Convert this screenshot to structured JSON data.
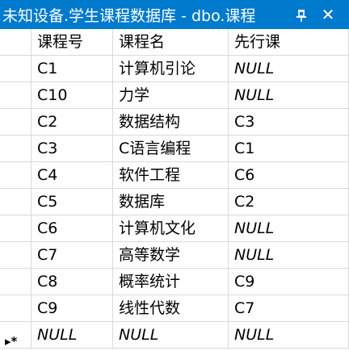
{
  "window": {
    "title": "未知设备.学生课程数据库 - dbo.课程",
    "pin_icon": "pin-icon",
    "close_icon": "close-icon",
    "close_glyph": "✕"
  },
  "grid": {
    "columns": [
      "课程号",
      "课程名",
      "先行课"
    ],
    "rows": [
      [
        "C1",
        "计算机引论",
        "NULL"
      ],
      [
        "C10",
        "力学",
        "NULL"
      ],
      [
        "C2",
        "数据结构",
        "C3"
      ],
      [
        "C3",
        "C语言编程",
        "C1"
      ],
      [
        "C4",
        "软件工程",
        "C6"
      ],
      [
        "C5",
        "数据库",
        "C2"
      ],
      [
        "C6",
        "计算机文化",
        "NULL"
      ],
      [
        "C7",
        "高等数学",
        "NULL"
      ],
      [
        "C8",
        "概率统计",
        "C9"
      ],
      [
        "C9",
        "线性代数",
        "C7"
      ]
    ],
    "new_row": [
      "NULL",
      "NULL",
      "NULL"
    ],
    "new_row_marker": "▸*"
  }
}
